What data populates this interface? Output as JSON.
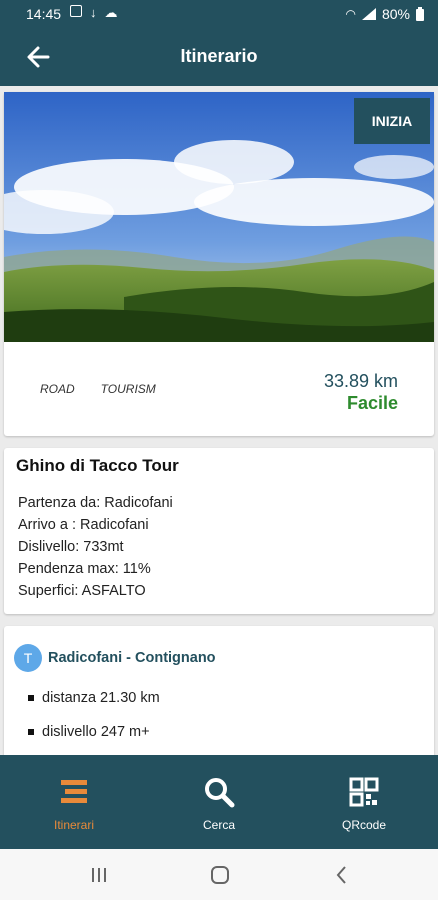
{
  "status_bar": {
    "time": "14:45",
    "battery": "80%",
    "icons_left": [
      "image-icon",
      "download-icon",
      "cloud-icon"
    ],
    "icons_right": [
      "wifi-icon",
      "signal-icon",
      "battery-icon"
    ]
  },
  "app_bar": {
    "title": "Itinerario",
    "back_icon": "arrow-left-icon"
  },
  "hero": {
    "start_label": "INIZIA",
    "tags": [
      "ROAD",
      "TOURISM"
    ],
    "distance": "33.89 km",
    "difficulty": "Facile"
  },
  "tour": {
    "title": "Ghino di Tacco Tour",
    "details": [
      "Partenza da: Radicofani",
      "Arrivo a : Radicofani",
      "Dislivello: 733mt",
      "Pendenza max: 11%",
      "Superfici: ASFALTO"
    ]
  },
  "segment": {
    "badge": "T",
    "title": "Radicofani - Contignano",
    "items": [
      "distanza 21.30 km",
      "dislivello 247 m+"
    ]
  },
  "bottom_nav": {
    "items": [
      {
        "label": "Itinerari",
        "icon": "list-icon",
        "active": true
      },
      {
        "label": "Cerca",
        "icon": "search-icon",
        "active": false
      },
      {
        "label": "QRcode",
        "icon": "qrcode-icon",
        "active": false
      }
    ]
  },
  "colors": {
    "primary": "#23505e",
    "accent": "#e88a3a",
    "difficulty": "#2e8b2e",
    "badge": "#5ea8e8"
  }
}
